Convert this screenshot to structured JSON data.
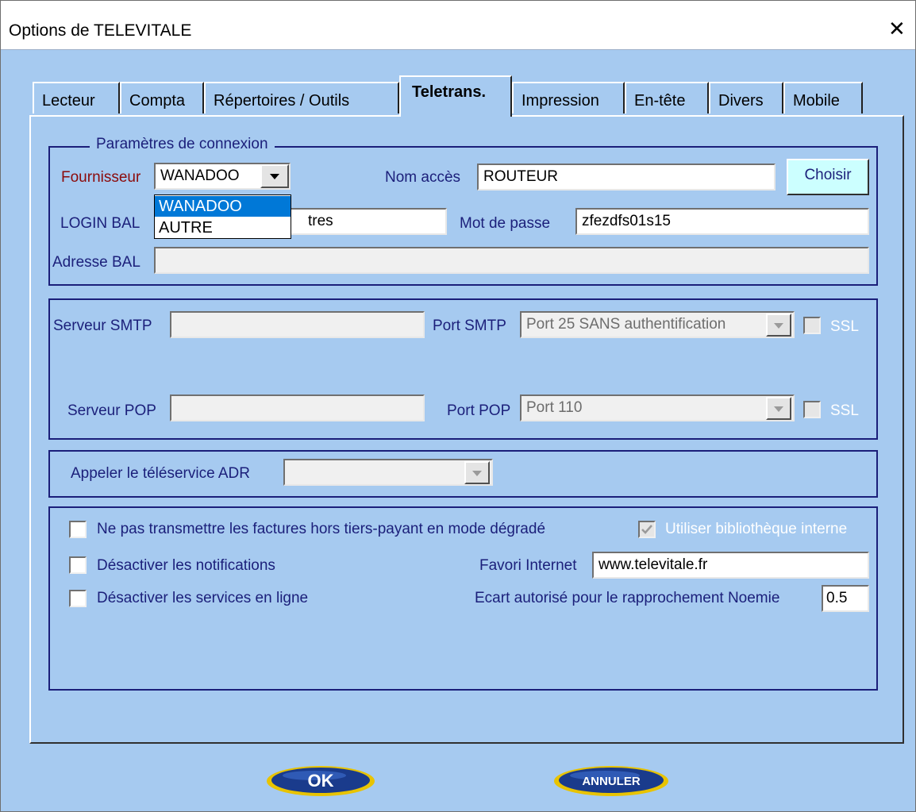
{
  "window": {
    "title": "Options de TELEVITALE",
    "close_icon": "close-icon"
  },
  "tabs": [
    {
      "label": "Lecteur"
    },
    {
      "label": "Compta"
    },
    {
      "label": "Répertoires / Outils"
    },
    {
      "label": "Teletrans.",
      "active": true
    },
    {
      "label": "Impression"
    },
    {
      "label": "En-tête"
    },
    {
      "label": "Divers"
    },
    {
      "label": "Mobile"
    }
  ],
  "connexion": {
    "legend": "Paramètres de connexion",
    "fournisseur_label": "Fournisseur",
    "fournisseur_value": "WANADOO",
    "fournisseur_options": [
      "WANADOO",
      "AUTRE"
    ],
    "nom_acces_label": "Nom accès",
    "nom_acces_value": "ROUTEUR",
    "choisir_label": "Choisir",
    "login_label": "LOGIN BAL",
    "login_value": "tres",
    "mot_de_passe_label": "Mot de passe",
    "mot_de_passe_value": "zfezdfs01s15",
    "adresse_label": "Adresse BAL",
    "adresse_value": ""
  },
  "serveurs": {
    "smtp_label": "Serveur SMTP",
    "smtp_value": "",
    "port_smtp_label": "Port SMTP",
    "port_smtp_value": "Port 25 SANS authentification",
    "ssl_label": "SSL",
    "pop_label": "Serveur POP",
    "pop_value": "",
    "port_pop_label": "Port POP",
    "port_pop_value": "Port 110",
    "ssl_pop_label": "SSL"
  },
  "adr": {
    "label": "Appeler le téléservice ADR",
    "value": ""
  },
  "divers": {
    "ne_pas_transmettre": "Ne pas transmettre les factures hors tiers-payant en mode dégradé",
    "utiliser_bibliotheque": "Utiliser bibliothèque interne",
    "desactiver_notifications": "Désactiver les notifications",
    "favori_label": "Favori Internet",
    "favori_value": "www.televitale.fr",
    "desactiver_services": "Désactiver les services en ligne",
    "ecart_label": "Ecart autorisé pour le rapprochement Noemie",
    "ecart_value": "0.5"
  },
  "buttons": {
    "ok": "OK",
    "annuler": "ANNULER"
  },
  "colors": {
    "background": "#a6caf0",
    "label_blue": "#1b1f7a",
    "label_red": "#8b0a0a",
    "selection": "#0078d7",
    "choisir_bg": "#ccffff"
  }
}
